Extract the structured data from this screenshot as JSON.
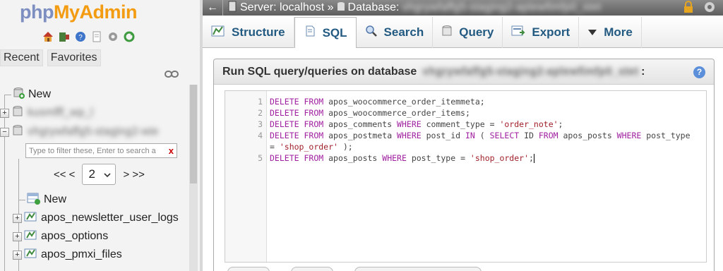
{
  "nav": {
    "logo_php": "php",
    "logo_my": "My",
    "logo_admin": "Admin",
    "tabs": [
      "Recent",
      "Favorites"
    ],
    "tree": {
      "new_root": "New",
      "db1": "kusmfff_wp_l",
      "db2": "vhgrywfaffg5-staging2-wie",
      "new_table": "New",
      "tables": [
        "apos_newsletter_user_logs",
        "apos_options",
        "apos_pmxi_files"
      ]
    },
    "filter_placeholder": "Type to filter these, Enter to search a",
    "filter_clear": "x",
    "pager": {
      "first": "<< <",
      "page": "2",
      "next": "> >>"
    }
  },
  "topbar": {
    "back": "←",
    "server": "Server: localhost »",
    "database_label": "Database:",
    "database_name": "vhgrywfaffg5-staging2-aplewfimfp0_stet"
  },
  "tabs": [
    {
      "label": "Structure",
      "icon": "structure-icon",
      "active": false
    },
    {
      "label": "SQL",
      "icon": "sql-icon",
      "active": true
    },
    {
      "label": "Search",
      "icon": "search-icon",
      "active": false
    },
    {
      "label": "Query",
      "icon": "query-icon",
      "active": false
    },
    {
      "label": "Export",
      "icon": "export-icon",
      "active": false
    },
    {
      "label": "More",
      "icon": "more-dropdown-icon",
      "active": false
    }
  ],
  "sql_panel": {
    "title": "Run SQL query/queries on database",
    "database_name": "vhgrywfaffg5-staging2-aplewfimfp0_stet",
    "colon": ":"
  },
  "editor": {
    "line_numbers": [
      "1",
      "2",
      "3",
      "4",
      "",
      "5"
    ],
    "lines": [
      "DELETE FROM apos_woocommerce_order_itemmeta;",
      "DELETE FROM apos_woocommerce_order_items;",
      "DELETE FROM apos_comments WHERE comment_type = 'order_note';",
      "DELETE FROM apos_postmeta WHERE post_id IN ( SELECT ID FROM apos_posts WHERE post_type",
      "= 'shop_order' );",
      "DELETE FROM apos_posts WHERE post_type = 'shop_order';"
    ]
  }
}
